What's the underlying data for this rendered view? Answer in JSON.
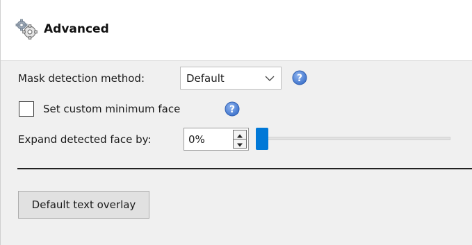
{
  "header": {
    "icon": "gears-icon",
    "title": "Advanced"
  },
  "mask_detection": {
    "label": "Mask detection method:",
    "selected": "Default",
    "help_icon": "help-icon"
  },
  "custom_min_face": {
    "label": "Set custom minimum face",
    "checked": false,
    "help_icon": "help-icon"
  },
  "expand_face": {
    "label": "Expand detected face by:",
    "value": "0%",
    "slider_level": 0
  },
  "text_overlay_button": {
    "label": "Default text overlay"
  },
  "colors": {
    "accent": "#0078d7",
    "help_icon": "#4a7fd4",
    "panel_background": "#f0f0f0",
    "header_background": "#ffffff"
  }
}
